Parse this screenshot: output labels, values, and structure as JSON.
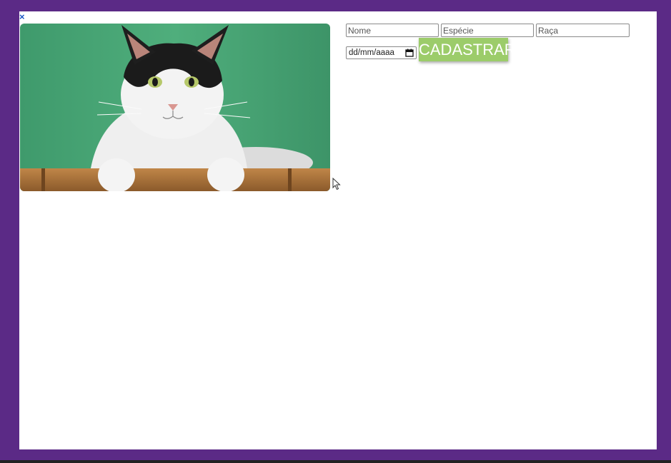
{
  "window": {
    "close_glyph": "×",
    "frame_color": "#5b2a86"
  },
  "photo": {
    "subject": "black and white cat on green background"
  },
  "form": {
    "name_placeholder": "Nome",
    "species_placeholder": "Espécie",
    "breed_placeholder": "Raça",
    "date_placeholder": "dd/mm/aaaa",
    "submit_label": "CADASTRAR",
    "submit_color": "#9ccc6a"
  },
  "icons": {
    "close": "close-icon",
    "calendar": "calendar-icon",
    "pointer": "mouse-pointer-icon"
  }
}
